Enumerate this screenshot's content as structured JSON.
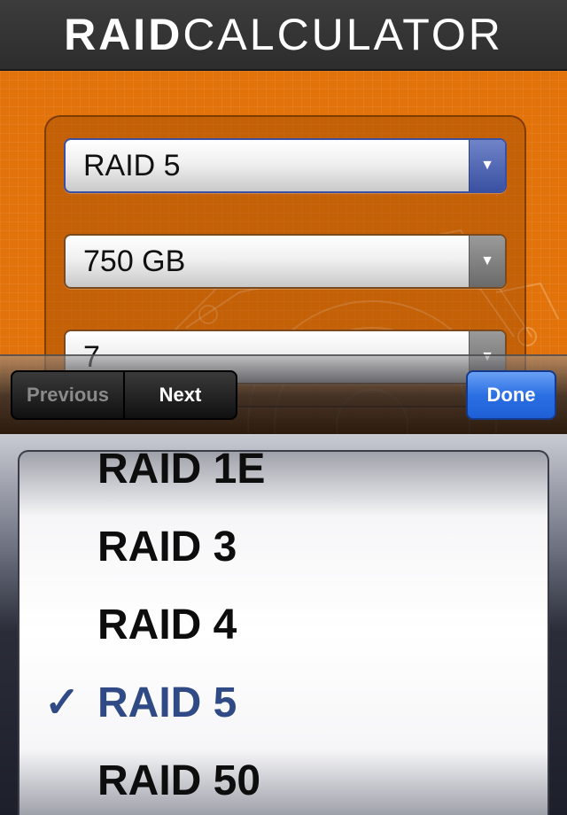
{
  "header": {
    "title_bold": "RAID",
    "title_light": "CALCULATOR"
  },
  "form": {
    "fields": [
      {
        "name": "raid-level-select",
        "value": "RAID 5",
        "active": true
      },
      {
        "name": "disk-size-select",
        "value": "750 GB",
        "active": false
      },
      {
        "name": "disk-count-select",
        "value": "7",
        "active": false
      }
    ]
  },
  "toolbar": {
    "previous_label": "Previous",
    "next_label": "Next",
    "done_label": "Done"
  },
  "picker": {
    "options": [
      "RAID 1E",
      "RAID 3",
      "RAID 4",
      "RAID 5",
      "RAID 50"
    ],
    "selected": "RAID 5",
    "check_mark": "✓"
  },
  "icons": {
    "dropdown": "triangle-down",
    "check": "check-mark"
  },
  "colors": {
    "header_bg": "#333333",
    "orange": "#e2730a",
    "accent_blue": "#304a85",
    "done_blue": "#2b6fe3"
  }
}
